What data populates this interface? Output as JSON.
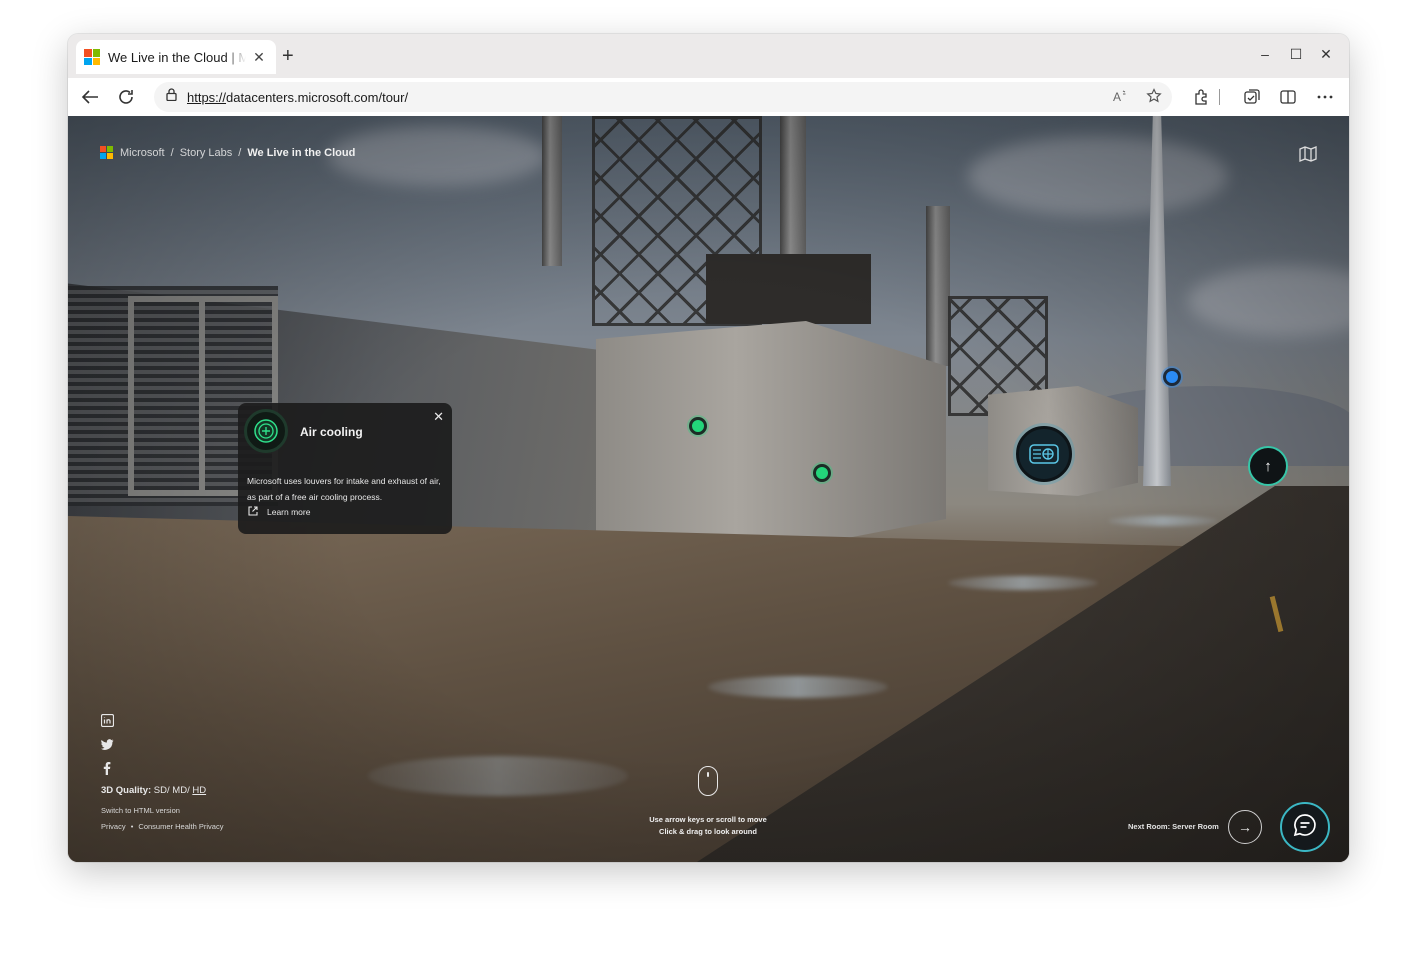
{
  "browser": {
    "tab_title": "We Live in the Cloud | Microsoft",
    "tab_close": "✕",
    "new_tab": "+",
    "address": {
      "scheme": "https://",
      "rest": "datacenters.microsoft.com/tour/"
    },
    "window_controls": {
      "minimize": "–",
      "maximize": "☐",
      "close": "✕"
    },
    "icons": [
      "back-icon",
      "refresh-icon",
      "lock-icon",
      "read-aloud-icon",
      "favorite-icon",
      "extensions-icon",
      "collections-icon",
      "split-screen-icon",
      "more-icon"
    ]
  },
  "page": {
    "breadcrumb": {
      "brand": "Microsoft",
      "sep1": "/",
      "section": "Story Labs",
      "sep2": "/",
      "current": "We Live in the Cloud"
    },
    "info_card": {
      "title": "Air cooling",
      "close": "✕",
      "body": "Microsoft uses louvers for intake and exhaust of air, as part of a free air cooling process.",
      "link": "Learn more"
    },
    "quality": {
      "label": "3D Quality:",
      "sd": "SD",
      "sep1": "/",
      "md": "MD",
      "sep2": "/",
      "hd": "HD"
    },
    "switch_html": "Switch to HTML version",
    "privacy": "Privacy",
    "bullet": "•",
    "consumer_privacy": "Consumer Health Privacy",
    "hint_line1": "Use arrow keys or scroll to move",
    "hint_line2": "Click & drag to look around",
    "next_room": "Next Room: Server Room",
    "next_arrow": "→",
    "up_arrow": "↑"
  },
  "colors": {
    "hotspot_green": "#23d57a",
    "hotspot_blue": "#2b8bf5",
    "accent_teal": "#36c6a8",
    "ms_red": "#f25022",
    "ms_green": "#7fba00",
    "ms_blue": "#00a4ef",
    "ms_yellow": "#ffb900"
  }
}
